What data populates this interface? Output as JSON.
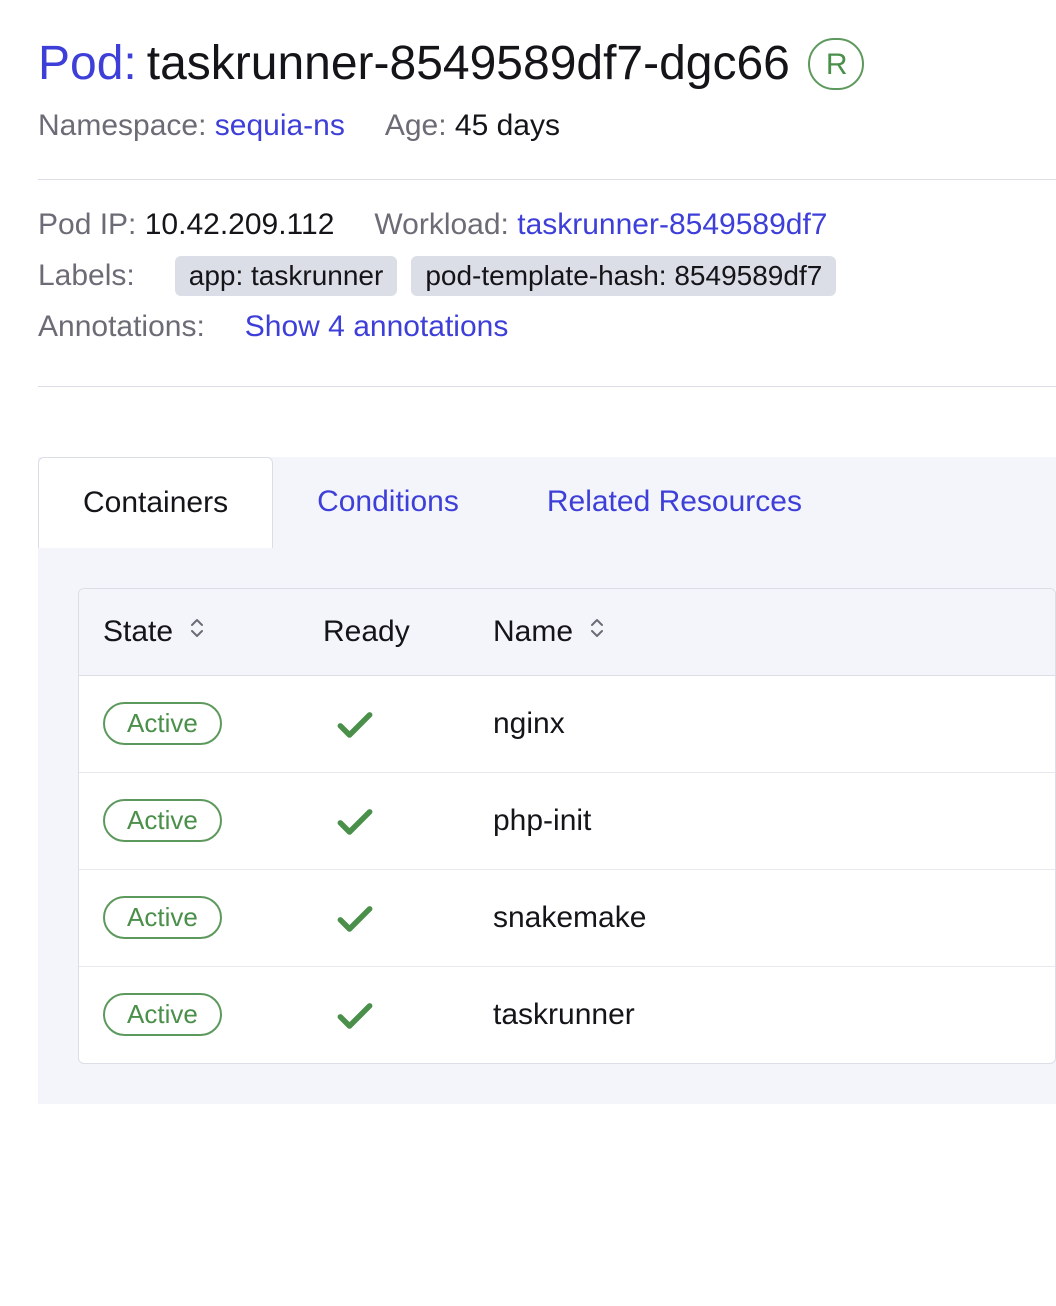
{
  "header": {
    "prefix": "Pod:",
    "name": "taskrunner-8549589df7-dgc66",
    "status_badge": "R"
  },
  "meta": {
    "namespace_label": "Namespace:",
    "namespace_value": "sequia-ns",
    "age_label": "Age:",
    "age_value": "45 days"
  },
  "details": {
    "podip_label": "Pod IP:",
    "podip_value": "10.42.209.112",
    "workload_label": "Workload:",
    "workload_value": "taskrunner-8549589df7",
    "labels_label": "Labels:",
    "label_chips": [
      "app: taskrunner",
      "pod-template-hash: 8549589df7"
    ],
    "annotations_label": "Annotations:",
    "annotations_link": "Show 4 annotations"
  },
  "tabs": {
    "containers": "Containers",
    "conditions": "Conditions",
    "related": "Related Resources"
  },
  "table": {
    "columns": {
      "state": "State",
      "ready": "Ready",
      "name": "Name"
    },
    "rows": [
      {
        "state": "Active",
        "ready": true,
        "name": "nginx"
      },
      {
        "state": "Active",
        "ready": true,
        "name": "php-init"
      },
      {
        "state": "Active",
        "ready": true,
        "name": "snakemake"
      },
      {
        "state": "Active",
        "ready": true,
        "name": "taskrunner"
      }
    ]
  }
}
